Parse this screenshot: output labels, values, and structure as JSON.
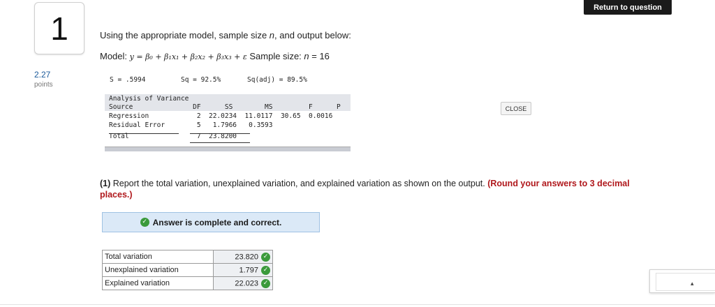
{
  "question": {
    "number": "1",
    "points_value": "2.27",
    "points_label": "points",
    "return_button": "Return to question"
  },
  "intro": {
    "text_before": "Using the appropriate model, sample size ",
    "n_var": "n",
    "text_after": ", and output below:"
  },
  "model": {
    "label": "Model: ",
    "equation": "y = β₀ + β₁x₁ + β₂x₂ + β₃x₃ + ε",
    "sample_label": "Sample size: ",
    "sample_var": "n",
    "sample_value": " = 16"
  },
  "stats": {
    "s": "S = .5994",
    "sq": "Sq = 92.5%",
    "sq_adj": "Sq(adj) = 89.5%"
  },
  "anova": {
    "title": "Analysis of Variance",
    "header": "Source               DF      SS        MS         F      P",
    "regression": "Regression            2  22.0234  11.0117  30.65  0.0016",
    "residual": "Residual Error        5   1.7966   0.3593",
    "total": "Total                 7  23.8200"
  },
  "close_button": "CLOSE",
  "part1": {
    "number": "(1)",
    "text": " Report the total variation, unexplained variation, and explained variation as shown on the output. ",
    "round_note": "(Round your answers to 3 decimal places.)"
  },
  "answer_banner": "Answer is complete and correct.",
  "answers": [
    {
      "label": "Total variation",
      "value": "23.820"
    },
    {
      "label": "Unexplained variation",
      "value": "1.797"
    },
    {
      "label": "Explained variation",
      "value": "22.023"
    }
  ],
  "colors": {
    "points": "#1b5a9a",
    "round_note": "#b0181c",
    "check": "#3b9a3b",
    "banner": "#dbe9f7"
  },
  "icons": {
    "check": "check-circle-icon",
    "caret": "caret-up-icon"
  }
}
